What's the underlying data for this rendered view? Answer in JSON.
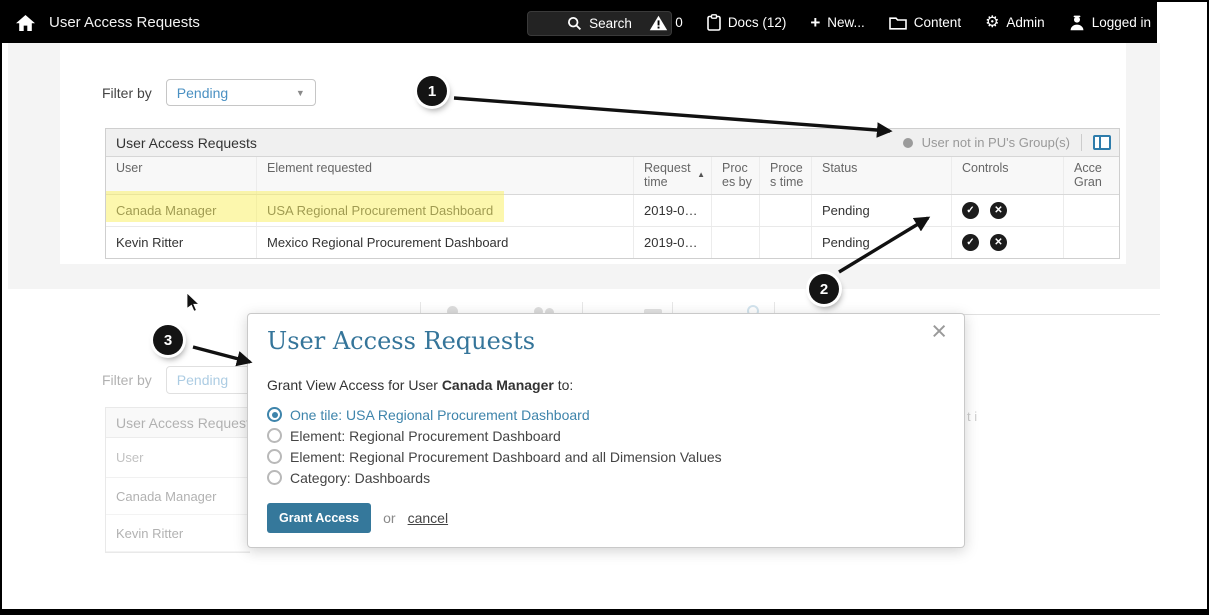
{
  "topbar": {
    "title": "User Access Requests",
    "search_label": "Search",
    "alerts_count": "0",
    "docs_label": "Docs (12)",
    "new_label": "New...",
    "content_label": "Content",
    "admin_label": "Admin",
    "login_label": "Logged in"
  },
  "icons": {
    "sort_asc": "▲",
    "dropdown_caret": "▼",
    "gear": "⚙",
    "plus": "+",
    "approve_check": "✓",
    "deny_x": "✕",
    "close": "×"
  },
  "filter": {
    "label": "Filter by",
    "value": "Pending"
  },
  "table": {
    "title": "User Access Requests",
    "legend": "User not in PU's Group(s)",
    "columns": [
      "User",
      "Element requested",
      "Request time",
      "Proces by",
      "Proces time",
      "Status",
      "Controls",
      "Acce Gran"
    ],
    "rows": [
      {
        "user": "Canada Manager",
        "element": "USA Regional Procurement Dashboard",
        "request_time": "2019-0…",
        "status": "Pending"
      },
      {
        "user": "Kevin Ritter",
        "element": "Mexico Regional Procurement Dashboard",
        "request_time": "2019-0…",
        "status": "Pending"
      }
    ]
  },
  "modal": {
    "title": "User Access Requests",
    "body_prefix": "Grant View Access for User ",
    "body_user": "Canada Manager",
    "body_suffix": " to:",
    "options": [
      {
        "label": "One tile: USA Regional Procurement Dashboard",
        "selected": true
      },
      {
        "label": "Element: Regional Procurement Dashboard",
        "selected": false
      },
      {
        "label": "Element: Regional Procurement Dashboard and all Dimension Values",
        "selected": false
      },
      {
        "label": "Category: Dashboards",
        "selected": false
      }
    ],
    "grant_label": "Grant Access",
    "or_label": "or",
    "cancel_label": "cancel"
  },
  "faded": {
    "filter_label": "Filter by",
    "filter_value": "Pending",
    "table_title": "User Access Requests",
    "col_user": "User",
    "rows": [
      "Canada Manager",
      "Kevin Ritter"
    ],
    "fragment": "t i"
  },
  "callouts": [
    "1",
    "2",
    "3"
  ]
}
